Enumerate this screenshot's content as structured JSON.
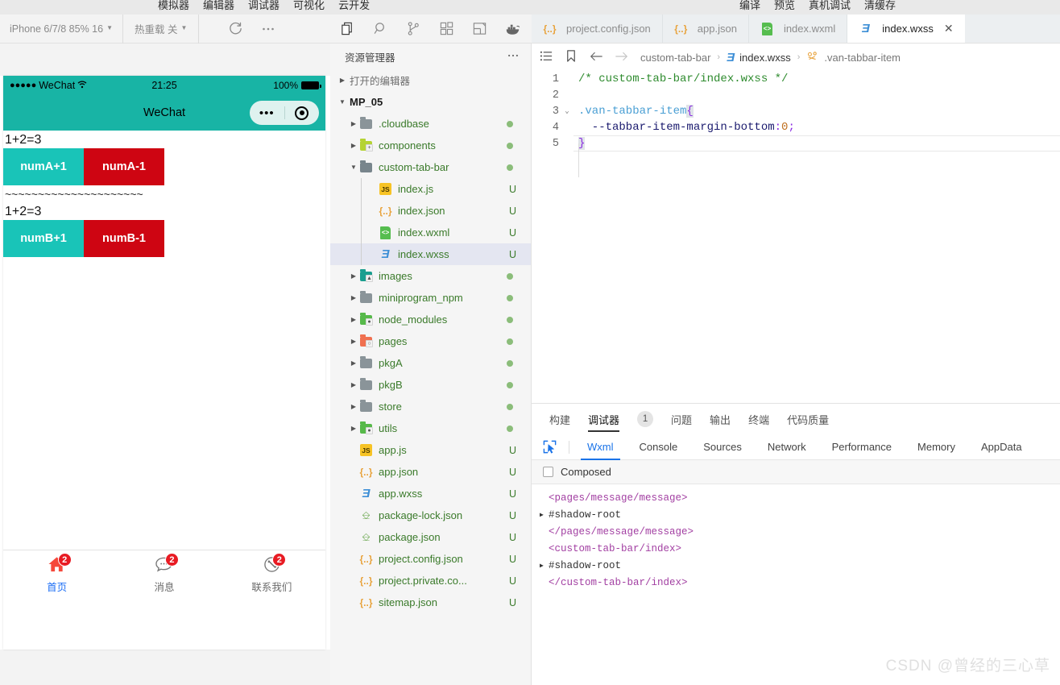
{
  "top_menu": {
    "left_items": [
      "模拟器",
      "编辑器",
      "调试器",
      "可视化",
      "云开发"
    ],
    "right_items": [
      "编译",
      "预览",
      "真机调试",
      "清缓存"
    ]
  },
  "sim_toolbar": {
    "device": "iPhone 6/7/8 85% 16",
    "hot_reload": "热重载 关",
    "refresh_icon": "refresh-icon",
    "more_icon": "more-icon"
  },
  "activity_bar": {
    "icons": [
      "files-icon",
      "search-icon",
      "source-control-icon",
      "extensions-icon",
      "layout-icon",
      "docker-icon"
    ]
  },
  "simulator": {
    "status_bar": {
      "signal_dots": "●●●●●",
      "carrier": "WeChat",
      "wifi_icon": "wifi-icon",
      "time": "21:25",
      "battery_percent": "100%"
    },
    "nav_title": "WeChat",
    "capsule": {
      "dots": "•••",
      "target_icon": "target-icon"
    },
    "content": {
      "line_a": "1+2=3",
      "buttons_a": [
        "numA+1",
        "numA-1"
      ],
      "divider": "~~~~~~~~~~~~~~~~~~~~~",
      "line_b": "1+2=3",
      "buttons_b": [
        "numB+1",
        "numB-1"
      ]
    },
    "tabbar": [
      {
        "icon": "home-icon",
        "label": "首页",
        "badge": "2",
        "active": true
      },
      {
        "icon": "message-icon",
        "label": "消息",
        "badge": "2",
        "active": false
      },
      {
        "icon": "contact-icon",
        "label": "联系我们",
        "badge": "2",
        "active": false
      }
    ],
    "colors": {
      "theme": "#18b4a5",
      "btn_teal": "#19c4b8",
      "btn_red": "#ce0512",
      "active_tab": "#1e6ff5",
      "badge": "#e81b23"
    }
  },
  "explorer": {
    "title": "资源管理器",
    "more_icon": "more-icon",
    "open_editors": "打开的编辑器",
    "root": "MP_05",
    "items": [
      {
        "label": ".cloudbase",
        "type": "folder",
        "icon": "folder-gray-icon",
        "indent": 1,
        "arrow": "▶",
        "status": "dot"
      },
      {
        "label": "components",
        "type": "folder",
        "icon": "folder-lime-icon",
        "indent": 1,
        "arrow": "▶",
        "status": "dot"
      },
      {
        "label": "custom-tab-bar",
        "type": "folder",
        "icon": "folder-open-icon",
        "indent": 1,
        "arrow": "▼",
        "status": "dot"
      },
      {
        "label": "index.js",
        "type": "file",
        "icon": "js-icon",
        "indent": 2,
        "arrow": "",
        "status": "U"
      },
      {
        "label": "index.json",
        "type": "file",
        "icon": "json-icon",
        "indent": 2,
        "arrow": "",
        "status": "U"
      },
      {
        "label": "index.wxml",
        "type": "file",
        "icon": "wxml-icon",
        "indent": 2,
        "arrow": "",
        "status": "U"
      },
      {
        "label": "index.wxss",
        "type": "file",
        "icon": "wxss-icon",
        "indent": 2,
        "arrow": "",
        "status": "U",
        "selected": true
      },
      {
        "label": "images",
        "type": "folder",
        "icon": "folder-teal-icon",
        "indent": 1,
        "arrow": "▶",
        "status": "dot"
      },
      {
        "label": "miniprogram_npm",
        "type": "folder",
        "icon": "folder-gray-icon",
        "indent": 1,
        "arrow": "▶",
        "status": "dot"
      },
      {
        "label": "node_modules",
        "type": "folder",
        "icon": "folder-green-icon",
        "indent": 1,
        "arrow": "▶",
        "status": "dot"
      },
      {
        "label": "pages",
        "type": "folder",
        "icon": "folder-orange-icon",
        "indent": 1,
        "arrow": "▶",
        "status": "dot"
      },
      {
        "label": "pkgA",
        "type": "folder",
        "icon": "folder-gray-icon",
        "indent": 1,
        "arrow": "▶",
        "status": "dot"
      },
      {
        "label": "pkgB",
        "type": "folder",
        "icon": "folder-gray-icon",
        "indent": 1,
        "arrow": "▶",
        "status": "dot"
      },
      {
        "label": "store",
        "type": "folder",
        "icon": "folder-gray-icon",
        "indent": 1,
        "arrow": "▶",
        "status": "dot"
      },
      {
        "label": "utils",
        "type": "folder",
        "icon": "folder-green-icon",
        "indent": 1,
        "arrow": "▶",
        "status": "dot"
      },
      {
        "label": "app.js",
        "type": "file",
        "icon": "js-icon",
        "indent": 1,
        "arrow": "",
        "status": "U"
      },
      {
        "label": "app.json",
        "type": "file",
        "icon": "json-icon",
        "indent": 1,
        "arrow": "",
        "status": "U"
      },
      {
        "label": "app.wxss",
        "type": "file",
        "icon": "wxss-icon",
        "indent": 1,
        "arrow": "",
        "status": "U"
      },
      {
        "label": "package-lock.json",
        "type": "file",
        "icon": "npm-icon",
        "indent": 1,
        "arrow": "",
        "status": "U"
      },
      {
        "label": "package.json",
        "type": "file",
        "icon": "npm-icon",
        "indent": 1,
        "arrow": "",
        "status": "U"
      },
      {
        "label": "project.config.json",
        "type": "file",
        "icon": "json-icon",
        "indent": 1,
        "arrow": "",
        "status": "U"
      },
      {
        "label": "project.private.co...",
        "type": "file",
        "icon": "json-icon",
        "indent": 1,
        "arrow": "",
        "status": "U"
      },
      {
        "label": "sitemap.json",
        "type": "file",
        "icon": "json-icon",
        "indent": 1,
        "arrow": "",
        "status": "U"
      }
    ]
  },
  "editor_tabs": [
    {
      "label": "project.config.json",
      "icon": "json-icon",
      "active": false
    },
    {
      "label": "app.json",
      "icon": "json-icon",
      "active": false
    },
    {
      "label": "index.wxml",
      "icon": "wxml-icon",
      "active": false
    },
    {
      "label": "index.wxss",
      "icon": "wxss-icon",
      "active": true,
      "close": "✕"
    }
  ],
  "breadcrumb": {
    "list_icon": "list-icon",
    "bookmark_icon": "bookmark-icon",
    "back_icon": "arrow-left-icon",
    "forward_icon": "arrow-right-icon",
    "parts": [
      "custom-tab-bar",
      "index.wxss",
      ".van-tabbar-item"
    ],
    "sep": "›"
  },
  "code": {
    "lines": [
      {
        "n": "1",
        "fold": "",
        "segments": [
          {
            "t": "/* custom-tab-bar/index.wxss */",
            "c": "c-comment"
          }
        ]
      },
      {
        "n": "2",
        "fold": "",
        "segments": []
      },
      {
        "n": "3",
        "fold": "⌄",
        "segments": [
          {
            "t": ".van-tabbar-item",
            "c": "c-selector"
          },
          {
            "t": "{",
            "c": "c-punct brace-hl"
          }
        ]
      },
      {
        "n": "4",
        "fold": "",
        "segments": [
          {
            "t": "  --tabbar-item-margin-bottom",
            "c": "c-prop"
          },
          {
            "t": ":",
            "c": "c-punct"
          },
          {
            "t": "0",
            "c": "c-num"
          },
          {
            "t": ";",
            "c": "c-punct"
          }
        ]
      },
      {
        "n": "5",
        "fold": "",
        "segments": [
          {
            "t": "}",
            "c": "c-punct brace-hl"
          }
        ]
      }
    ]
  },
  "debugger": {
    "panel_tabs": [
      {
        "label": "构建",
        "active": false
      },
      {
        "label": "调试器",
        "active": true,
        "count": "1"
      },
      {
        "label": "问题",
        "active": false
      },
      {
        "label": "输出",
        "active": false
      },
      {
        "label": "终端",
        "active": false
      },
      {
        "label": "代码质量",
        "active": false
      }
    ],
    "inspect_icon": "inspect-element-icon",
    "devtools_tabs": [
      {
        "label": "Wxml",
        "active": true
      },
      {
        "label": "Console",
        "active": false
      },
      {
        "label": "Sources",
        "active": false
      },
      {
        "label": "Network",
        "active": false
      },
      {
        "label": "Performance",
        "active": false
      },
      {
        "label": "Memory",
        "active": false
      },
      {
        "label": "AppData",
        "active": false
      }
    ],
    "composed_label": "Composed",
    "composed_checked": false,
    "wxml_tree": [
      {
        "text": "<pages/message/message>",
        "tri": "",
        "kind": "tag"
      },
      {
        "text": "#shadow-root",
        "tri": "▶",
        "kind": "shadow"
      },
      {
        "text": "</pages/message/message>",
        "tri": "",
        "kind": "tag"
      },
      {
        "text": "<custom-tab-bar/index>",
        "tri": "",
        "kind": "tag"
      },
      {
        "text": "#shadow-root",
        "tri": "▶",
        "kind": "shadow"
      },
      {
        "text": "</custom-tab-bar/index>",
        "tri": "",
        "kind": "tag"
      }
    ]
  },
  "watermark": "CSDN @曾经的三心草"
}
